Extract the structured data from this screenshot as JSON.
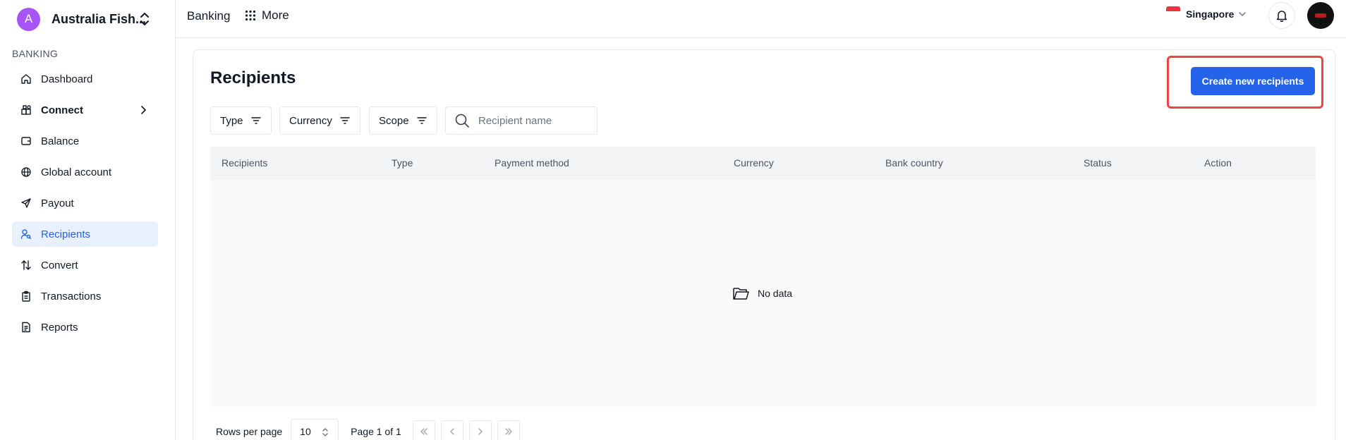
{
  "sidebar": {
    "org_initial": "A",
    "org_name": "Australia Fish...",
    "section": "BANKING",
    "items": [
      {
        "label": "Dashboard",
        "icon": "home-icon"
      },
      {
        "label": "Connect",
        "icon": "connect-icon"
      },
      {
        "label": "Balance",
        "icon": "wallet-icon"
      },
      {
        "label": "Global account",
        "icon": "globe-icon"
      },
      {
        "label": "Payout",
        "icon": "send-icon"
      },
      {
        "label": "Recipients",
        "icon": "user-search-icon"
      },
      {
        "label": "Convert",
        "icon": "convert-icon"
      },
      {
        "label": "Transactions",
        "icon": "clipboard-icon"
      },
      {
        "label": "Reports",
        "icon": "file-icon"
      }
    ],
    "active_item": "Recipients"
  },
  "topbar": {
    "title": "Banking",
    "more_label": "More",
    "region": "Singapore"
  },
  "main": {
    "title": "Recipients",
    "create_button": "Create new recipients",
    "filters": [
      "Type",
      "Currency",
      "Scope"
    ],
    "search_placeholder": "Recipient name",
    "columns": [
      "Recipients",
      "Type",
      "Payment method",
      "Currency",
      "Bank country",
      "Status",
      "Action"
    ],
    "empty_text": "No data"
  },
  "pagination": {
    "rows_label": "Rows per page",
    "rows_value": "10",
    "page_info": "Page 1 of 1"
  },
  "colors": {
    "accent": "#2563eb",
    "highlight": "#ef4444",
    "avatar": "#a855f7"
  }
}
